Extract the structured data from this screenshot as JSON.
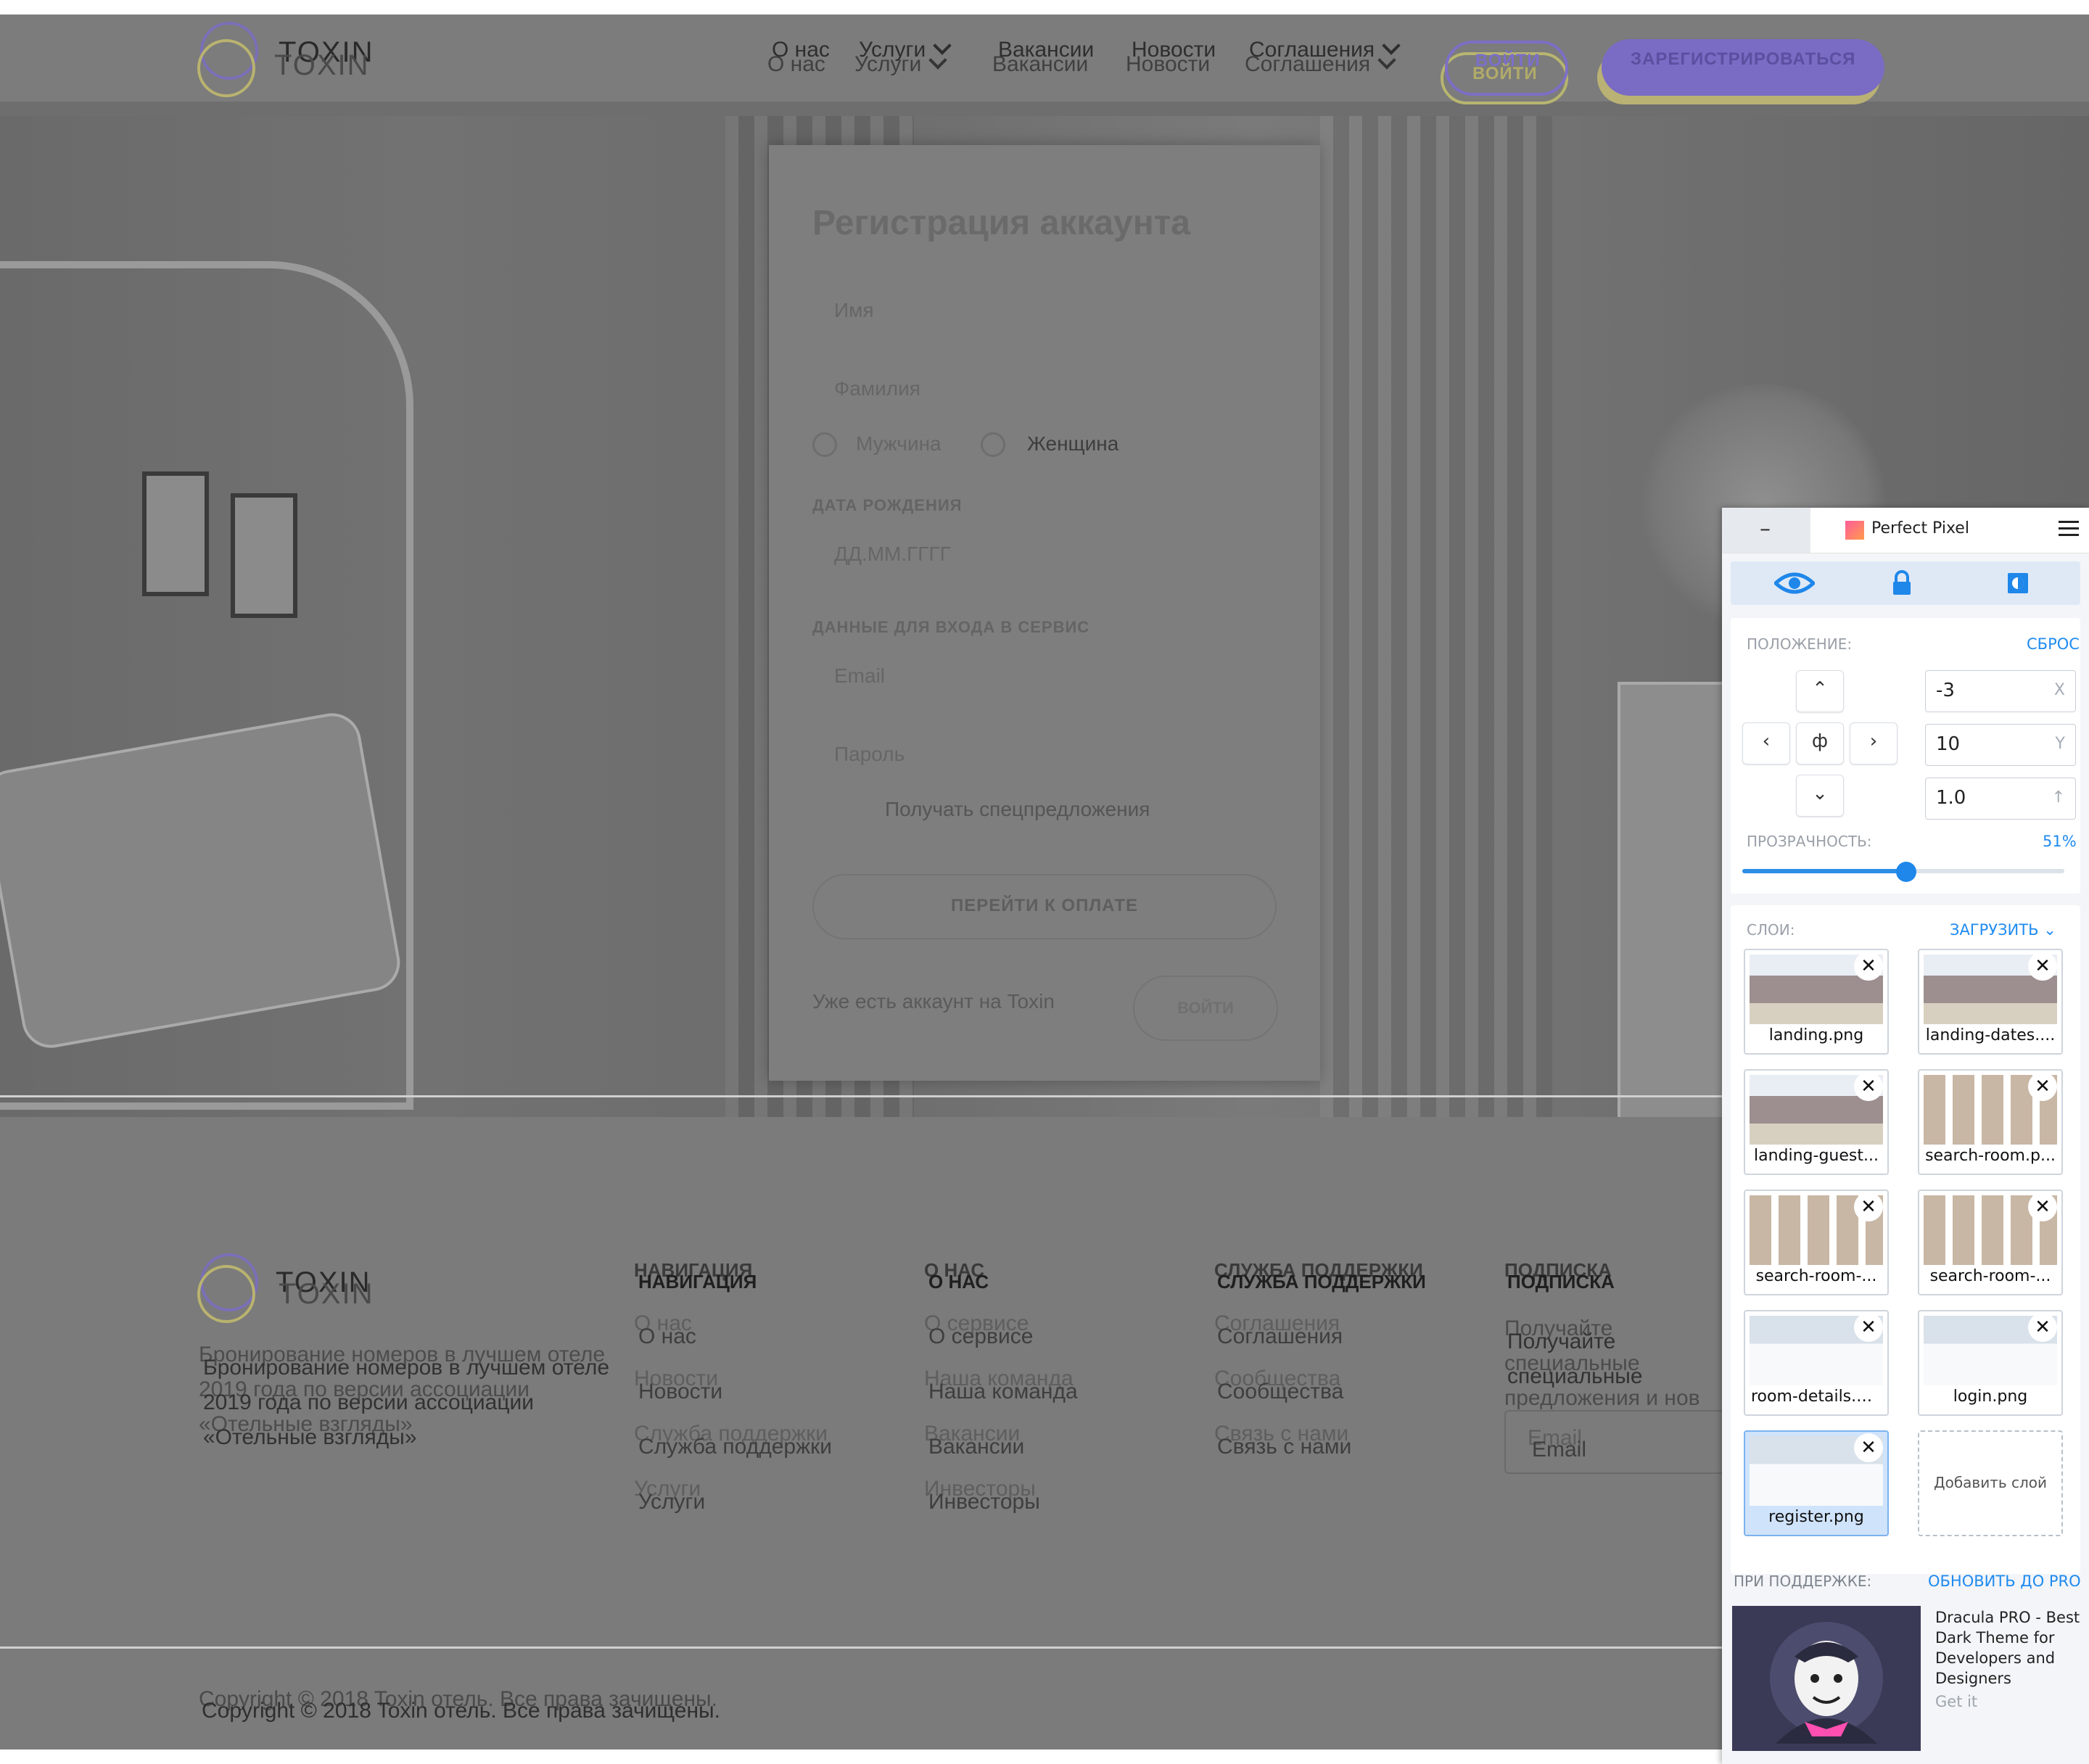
{
  "header": {
    "brand": "TOXIN",
    "nav": [
      {
        "label": "О нас",
        "dropdown": false
      },
      {
        "label": "Услуги",
        "dropdown": true
      },
      {
        "label": "Вакансии",
        "dropdown": false
      },
      {
        "label": "Новости",
        "dropdown": false
      },
      {
        "label": "Соглашения",
        "dropdown": true
      }
    ],
    "login_label": "ВОЙТИ",
    "register_label": "ЗАРЕГИСТРИРОВАТЬСЯ"
  },
  "form": {
    "title": "Регистрация аккаунта",
    "first_name_placeholder": "Имя",
    "last_name_placeholder": "Фамилия",
    "gender": {
      "male": "Мужчина",
      "female": "Женщина"
    },
    "birthdate_section": "ДАТА РОЖДЕНИЯ",
    "birthdate_placeholder": "ДД.ММ.ГГГГ",
    "login_section": "ДАННЫЕ ДЛЯ ВХОДА В СЕРВИС",
    "email_placeholder": "Email",
    "password_placeholder": "Пароль",
    "offers_label": "Получать спецпредложения",
    "submit_label": "ПЕРЕЙТИ К ОПЛАТЕ",
    "have_account": "Уже есть аккаунт на Toxin",
    "login_label": "ВОЙТИ"
  },
  "footer": {
    "brand": "TOXIN",
    "about": "Бронирование номеров в лучшем отеле 2019 года по версии ассоциации «Отельные взгляды»",
    "columns": [
      {
        "heading": "НАВИГАЦИЯ",
        "links": [
          "О нас",
          "Новости",
          "Служба поддержки",
          "Услуги"
        ]
      },
      {
        "heading": "О НАС",
        "links": [
          "О сервисе",
          "Наша команда",
          "Вакансии",
          "Инвесторы"
        ]
      },
      {
        "heading": "СЛУЖБА ПОДДЕРЖКИ",
        "links": [
          "Соглашения",
          "Сообщества",
          "Связь с нами"
        ]
      }
    ],
    "subscribe": {
      "heading": "ПОДПИСКА",
      "text": "Получайте специальные предложения и нов",
      "email_placeholder": "Email"
    },
    "copyright": "Copyright © 2018 Toxin отель. Все права зачищены."
  },
  "perfect_pixel": {
    "minimize": "–",
    "brand": "Perfect Pixel",
    "position_label": "ПОЛОЖЕНИЕ:",
    "reset_label": "СБРОС",
    "x": "-3",
    "x_unit": "X",
    "y": "10",
    "y_unit": "Y",
    "scale": "1.0",
    "scale_unit": "↑",
    "center_glyph": "ф",
    "opacity_label": "ПРОЗРАЧНОСТЬ:",
    "opacity_value": "51%",
    "opacity": 0.51,
    "layers_label": "СЛОИ:",
    "upload_label": "ЗАГРУЗИТЬ",
    "layers": [
      {
        "name": "landing.png",
        "active": false
      },
      {
        "name": "landing-dates....",
        "active": false
      },
      {
        "name": "landing-guest...",
        "active": false
      },
      {
        "name": "search-room.p...",
        "active": false
      },
      {
        "name": "search-room-...",
        "active": false
      },
      {
        "name": "search-room-...",
        "active": false
      },
      {
        "name": "room-details.p...",
        "active": false
      },
      {
        "name": "login.png",
        "active": false
      },
      {
        "name": "register.png",
        "active": true
      }
    ],
    "add_layer": "Добавить слой",
    "sponsor_label": "ПРИ ПОДДЕРЖКЕ:",
    "upgrade_label": "ОБНОВИТЬ ДО PRO",
    "ad_title": "Dracula PRO - Best Dark Theme for Developers and Designers",
    "ad_cta": "Get it"
  }
}
